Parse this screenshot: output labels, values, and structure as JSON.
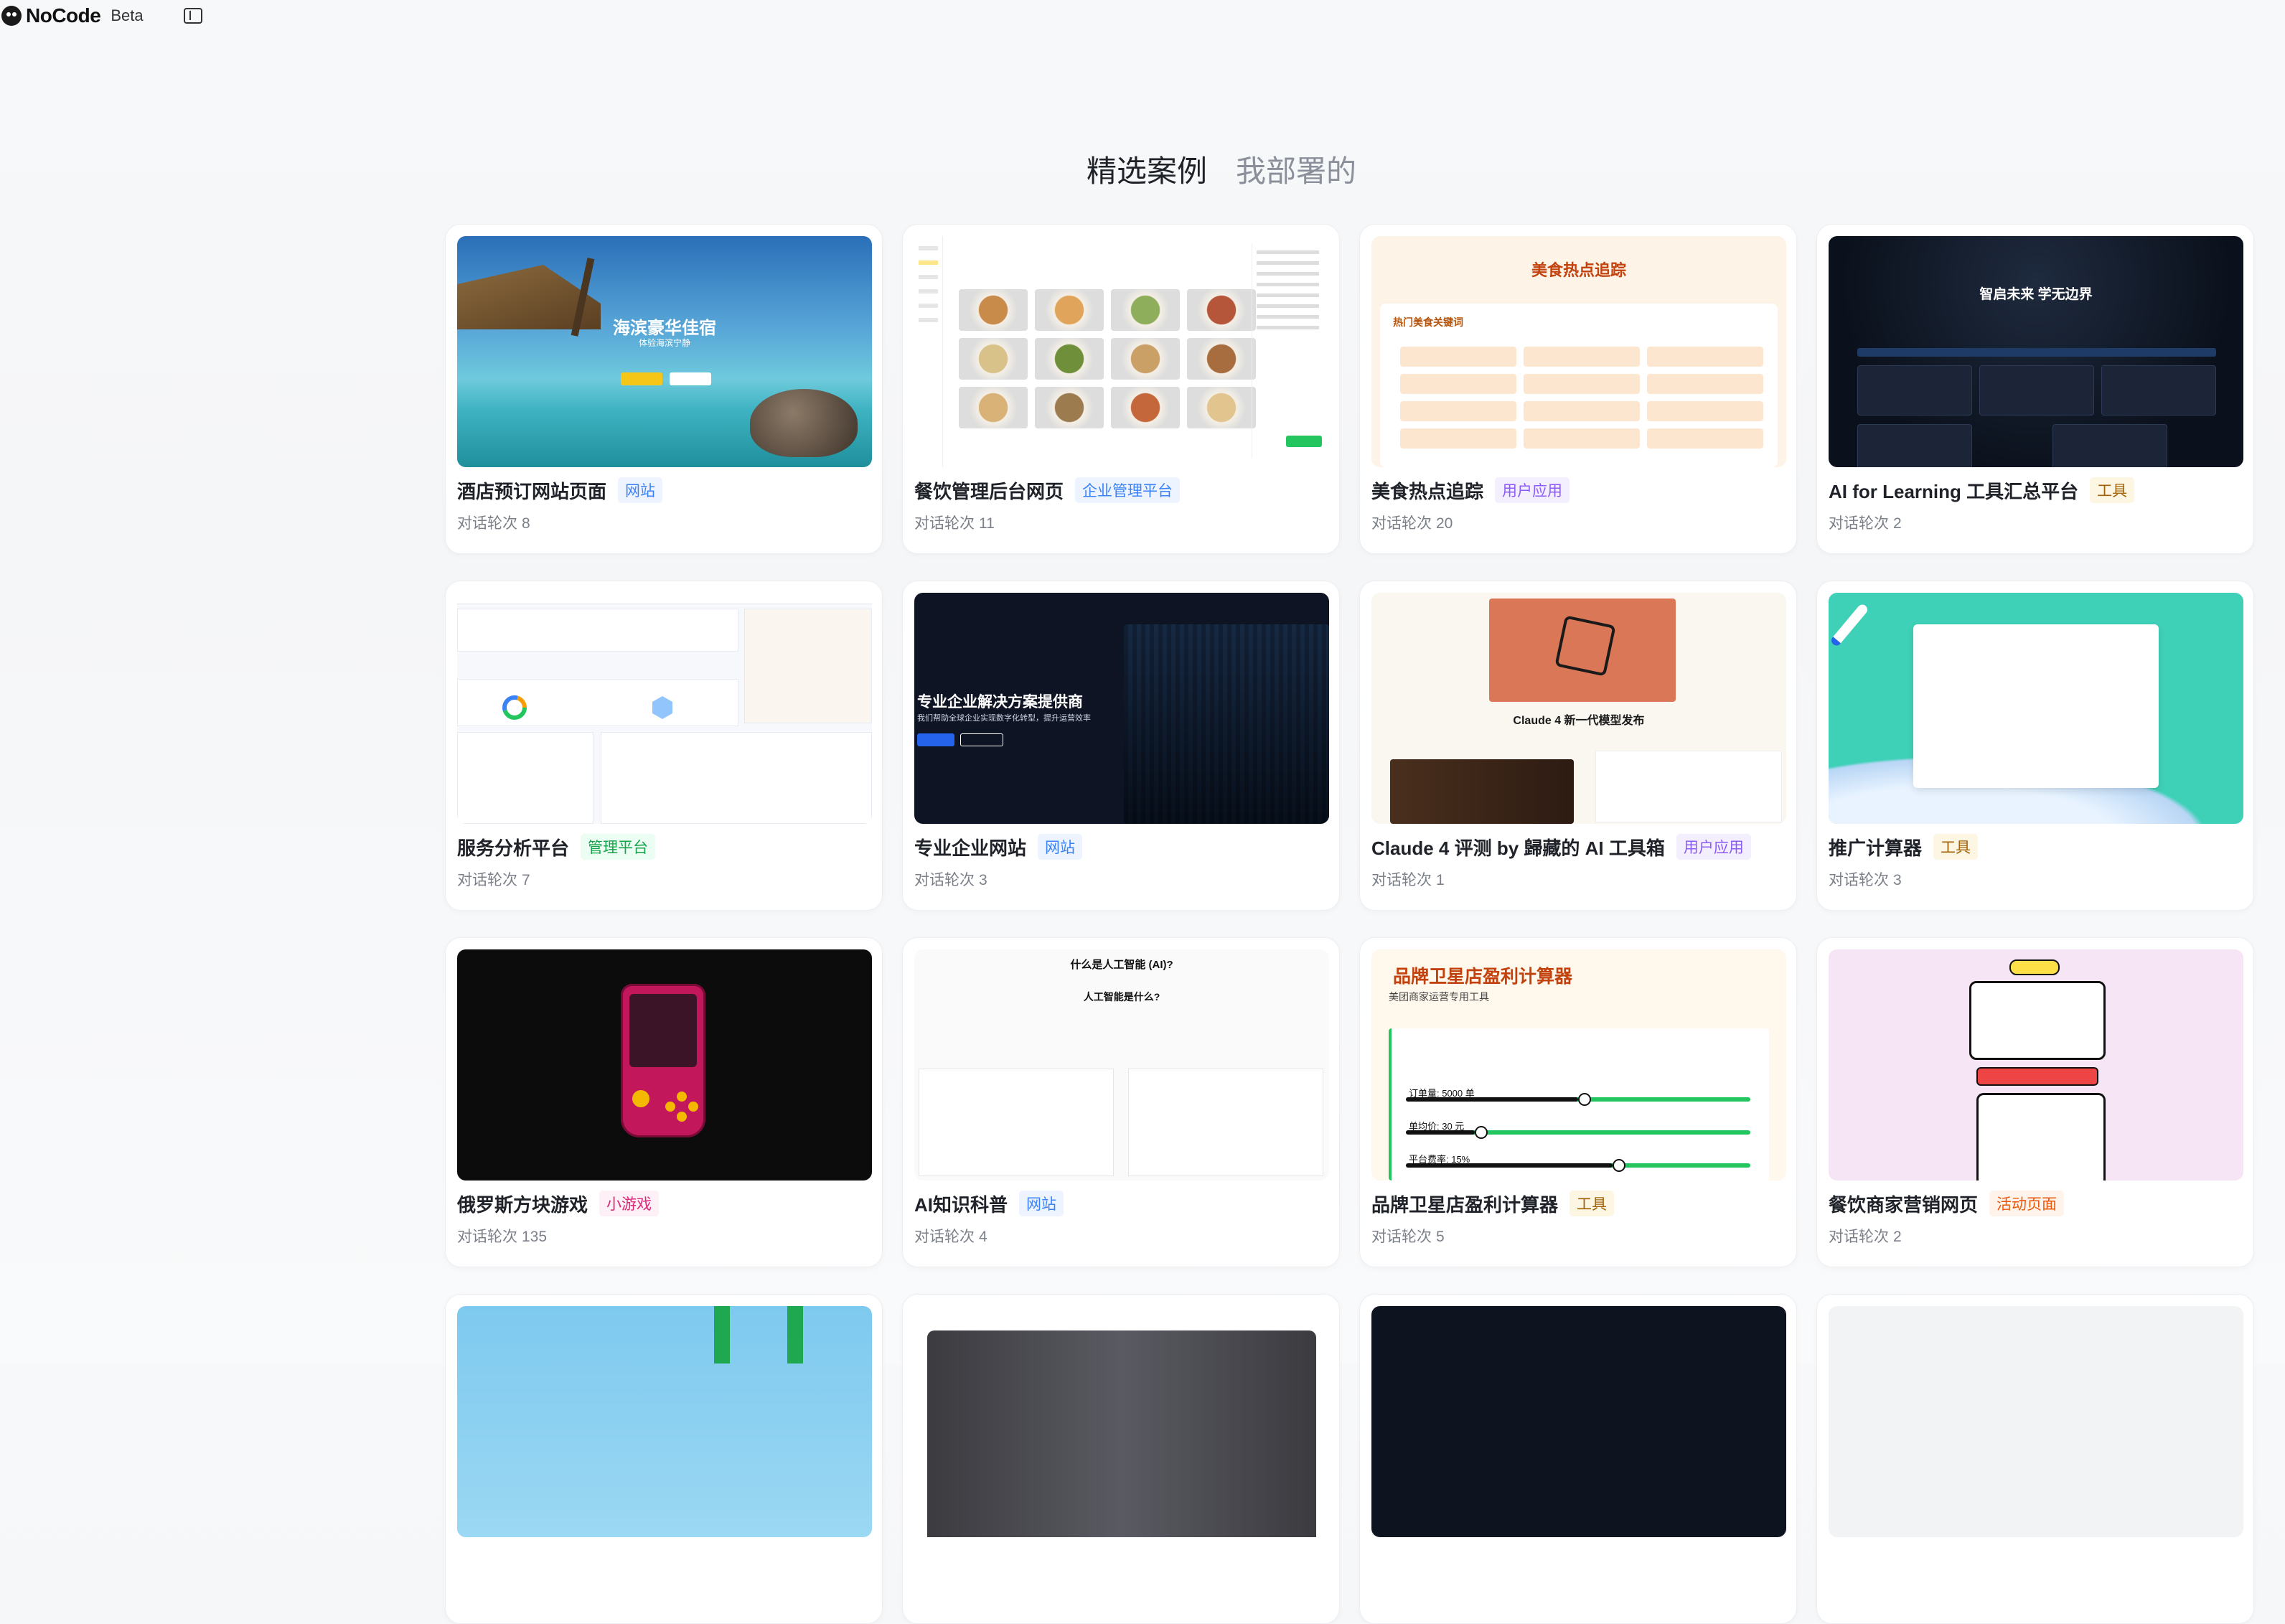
{
  "app": {
    "brand": "NoCode",
    "badge": "Beta"
  },
  "tabs": [
    {
      "label": "精选案例",
      "active": true
    },
    {
      "label": "我部署的",
      "active": false
    }
  ],
  "rounds_label": "对话轮次",
  "cards": [
    {
      "title": "酒店预订网站页面",
      "tag": "网站",
      "tag_color": "#3b82f6",
      "tag_bg": "#eef4ff",
      "rounds": "8",
      "thumb": {
        "h1": "海滨豪华佳宿",
        "h2": "体验海滨宁静"
      }
    },
    {
      "title": "餐饮管理后台网页",
      "tag": "企业管理平台",
      "tag_color": "#3b82f6",
      "tag_bg": "#eef4ff",
      "rounds": "11"
    },
    {
      "title": "美食热点追踪",
      "tag": "用户应用",
      "tag_color": "#8b5cf6",
      "tag_bg": "#f4efff",
      "rounds": "20",
      "thumb": {
        "h1": "美食热点追踪",
        "label": "热门美食关键词"
      }
    },
    {
      "title": "AI for Learning 工具汇总平台",
      "tag": "工具",
      "tag_color": "#a16207",
      "tag_bg": "#fdf6e3",
      "rounds": "2",
      "thumb": {
        "h1": "智启未来 学无边界"
      }
    },
    {
      "title": "服务分析平台",
      "tag": "管理平台",
      "tag_color": "#16a34a",
      "tag_bg": "#ecfdf3",
      "rounds": "7"
    },
    {
      "title": "专业企业网站",
      "tag": "网站",
      "tag_color": "#3b82f6",
      "tag_bg": "#eef4ff",
      "rounds": "3",
      "thumb": {
        "h1": "专业企业解决方案提供商",
        "h2": "我们帮助全球企业实现数字化转型，提升运营效率"
      }
    },
    {
      "title": "Claude 4 评测 by 歸藏的 AI 工具箱",
      "tag": "用户应用",
      "tag_color": "#8b5cf6",
      "tag_bg": "#f4efff",
      "rounds": "1",
      "thumb": {
        "h1": "Claude 4 新一代模型发布"
      }
    },
    {
      "title": "推广计算器",
      "tag": "工具",
      "tag_color": "#a16207",
      "tag_bg": "#fdf6e3",
      "rounds": "3"
    },
    {
      "title": "俄罗斯方块游戏",
      "tag": "小游戏",
      "tag_color": "#db2777",
      "tag_bg": "#fdf0f6",
      "rounds": "135"
    },
    {
      "title": "AI知识科普",
      "tag": "网站",
      "tag_color": "#3b82f6",
      "tag_bg": "#eef4ff",
      "rounds": "4",
      "thumb": {
        "h1": "什么是人工智能 (AI)?",
        "h2": "人工智能是什么?"
      }
    },
    {
      "title": "品牌卫星店盈利计算器",
      "tag": "工具",
      "tag_color": "#a16207",
      "tag_bg": "#fdf6e3",
      "rounds": "5",
      "thumb": {
        "h1": "品牌卫星店盈利计算器",
        "h2": "美团商家运营专用工具",
        "s1": "订单量: 5000 单",
        "s2": "单均价: 30 元",
        "s3": "平台费率: 15%",
        "f1": 0.5,
        "f2": 0.2,
        "f3": 0.6
      }
    },
    {
      "title": "餐饮商家营销网页",
      "tag": "活动页面",
      "tag_color": "#ea580c",
      "tag_bg": "#fff4ec",
      "rounds": "2"
    }
  ]
}
